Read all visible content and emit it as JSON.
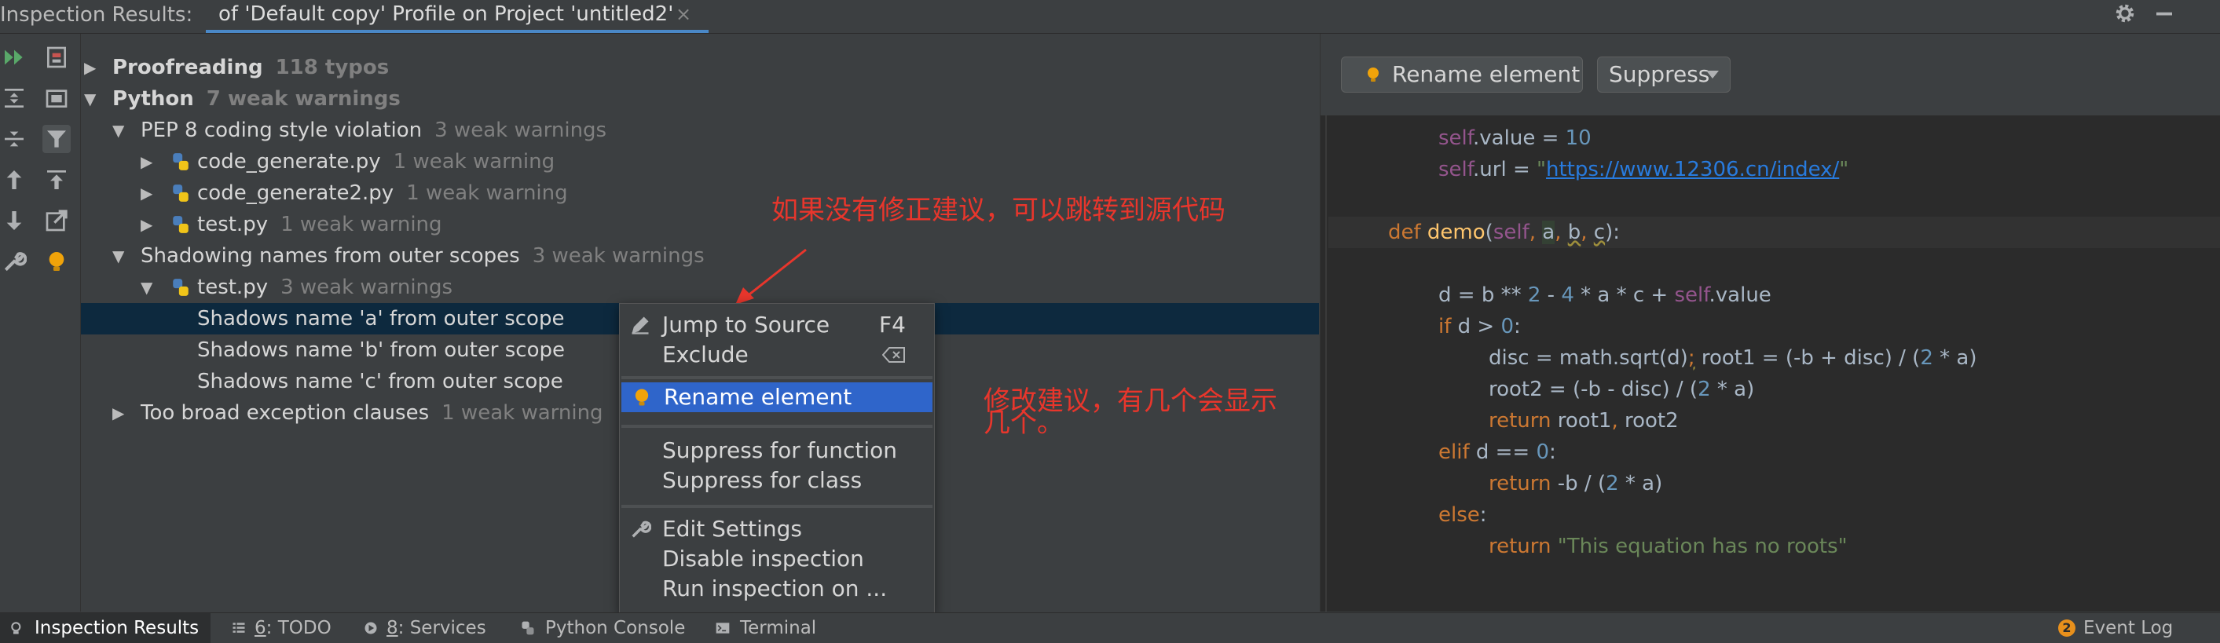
{
  "title_bar": {
    "label": "Inspection Results:",
    "tab_title": "of 'Default copy' Profile on Project 'untitled2'",
    "tab_close": "×"
  },
  "tree": {
    "rows": [
      {
        "label": "Proofreading",
        "count": "118 typos"
      },
      {
        "label": "Python",
        "count": "7 weak warnings"
      },
      {
        "label": "PEP 8 coding style violation",
        "count": "3 weak warnings"
      },
      {
        "label": "code_generate.py",
        "count": "1 weak warning"
      },
      {
        "label": "code_generate2.py",
        "count": "1 weak warning"
      },
      {
        "label": "test.py",
        "count": "1 weak warning"
      },
      {
        "label": "Shadowing names from outer scopes",
        "count": "3 weak warnings"
      },
      {
        "label": "test.py",
        "count": "3 weak warnings"
      },
      {
        "label": "Shadows name 'a' from outer scope",
        "count": ""
      },
      {
        "label": "Shadows name 'b' from outer scope",
        "count": ""
      },
      {
        "label": "Shadows name 'c' from outer scope",
        "count": ""
      },
      {
        "label": "Too broad exception clauses",
        "count": "1 weak warning"
      }
    ]
  },
  "annotations": {
    "jump_hint": "如果没有修正建议，可以跳转到源代码",
    "fix_hint_line1": "修改建议，有几个会显示",
    "fix_hint_line2": "几个。"
  },
  "popup_menu": {
    "jump_to_source": "Jump to Source",
    "jump_shortcut": "F4",
    "exclude": "Exclude",
    "rename_element": "Rename element",
    "suppress_function": "Suppress for function",
    "suppress_class": "Suppress for class",
    "edit_settings": "Edit Settings",
    "disable_inspection": "Disable inspection",
    "run_inspection": "Run inspection on ..."
  },
  "preview": {
    "rename_button": "Rename element",
    "suppress_button": "Suppress",
    "code": {
      "l1_self": "self",
      "l1_rest": ".value = ",
      "l1_num": "10",
      "l2_self": "self",
      "l2_rest": ".url = ",
      "l2_q1": "\"",
      "l2_url": "https://www.12306.cn/index/",
      "l2_q2": "\"",
      "l4_def": "def ",
      "l4_fn": "demo",
      "l4_open": "(",
      "l4_self": "self",
      "l4_c1": ", ",
      "l4_a": "a",
      "l4_c2": ", ",
      "l4_b": "b",
      "l4_c3": ", ",
      "l4_c": "c",
      "l4_close": "):",
      "l6_a": "d = b ** ",
      "l6_n2": "2",
      "l6_b": " - ",
      "l6_n4": "4",
      "l6_c": " * a * c + ",
      "l6_self": "self",
      "l6_d": ".value",
      "l7_if": "if",
      "l7_a": " d > ",
      "l7_n": "0",
      "l7_b": ":",
      "l8_a": "disc = math.sqrt(d)",
      "l8_semi": ";",
      "l8_b": " root1 = (-b + disc) / (",
      "l8_n": "2",
      "l8_c": " * a)",
      "l9_a": "root2 = (-b - disc) / (",
      "l9_n": "2",
      "l9_b": " * a)",
      "l10_ret": "return",
      "l10_a": " root1",
      "l10_comma": ",",
      "l10_b": " root2",
      "l11_elif": "elif",
      "l11_a": " d == ",
      "l11_n": "0",
      "l11_b": ":",
      "l12_ret": "return",
      "l12_a": " -b / (",
      "l12_n": "2",
      "l12_b": " * a)",
      "l13_else": "else",
      "l13_b": ":",
      "l14_ret": "return ",
      "l14_str": "\"This equation has no roots\""
    }
  },
  "status_bar": {
    "inspection_results": "Inspection Results",
    "todo_num": "6",
    "todo_label": ": TODO",
    "services_num": "8",
    "services_label": ": Services",
    "python_console": "Python Console",
    "terminal": "Terminal",
    "event_log_badge": "2",
    "event_log": "Event Log"
  },
  "colors": {
    "selection": "#0d293e",
    "menu_highlight": "#2f65ca",
    "annotation_red": "#e8362c",
    "bulb": "#f0a30a",
    "run_green": "#59a869"
  }
}
